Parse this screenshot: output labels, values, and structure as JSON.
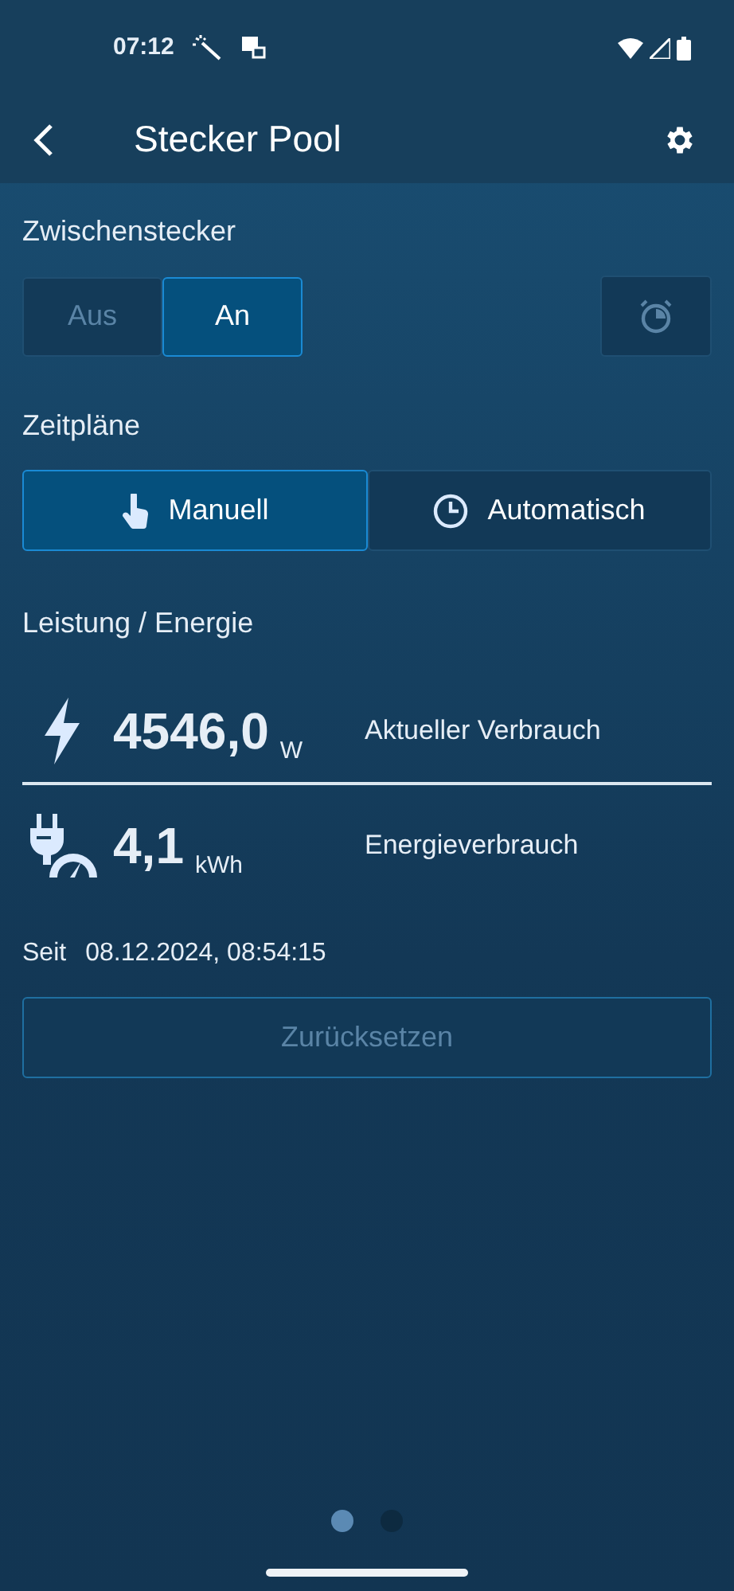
{
  "status_bar": {
    "time": "07:12"
  },
  "header": {
    "title": "Stecker Pool"
  },
  "switch_section": {
    "label": "Zwischenstecker",
    "options": [
      {
        "label": "Aus",
        "selected": false
      },
      {
        "label": "An",
        "selected": true
      }
    ],
    "timer_button": {
      "disabled": true
    }
  },
  "schedule_section": {
    "label": "Zeitpläne",
    "options": [
      {
        "label": "Manuell",
        "kind": "hand",
        "selected": true
      },
      {
        "label": "Automatisch",
        "kind": "clock",
        "selected": false
      }
    ]
  },
  "energy_section": {
    "label": "Leistung / Energie",
    "readings": [
      {
        "kind": "power",
        "value": "4546,0",
        "unit": "W",
        "caption": "Aktueller Verbrauch"
      },
      {
        "kind": "energy",
        "value": "4,1",
        "unit": "kWh",
        "caption": "Energieverbrauch"
      }
    ],
    "since_label": "Seit",
    "since_value": "08.12.2024, 08:54:15",
    "reset_button": {
      "label": "Zurücksetzen",
      "disabled": true
    }
  },
  "pager": [
    {
      "selected": true
    },
    {
      "selected": false
    }
  ]
}
